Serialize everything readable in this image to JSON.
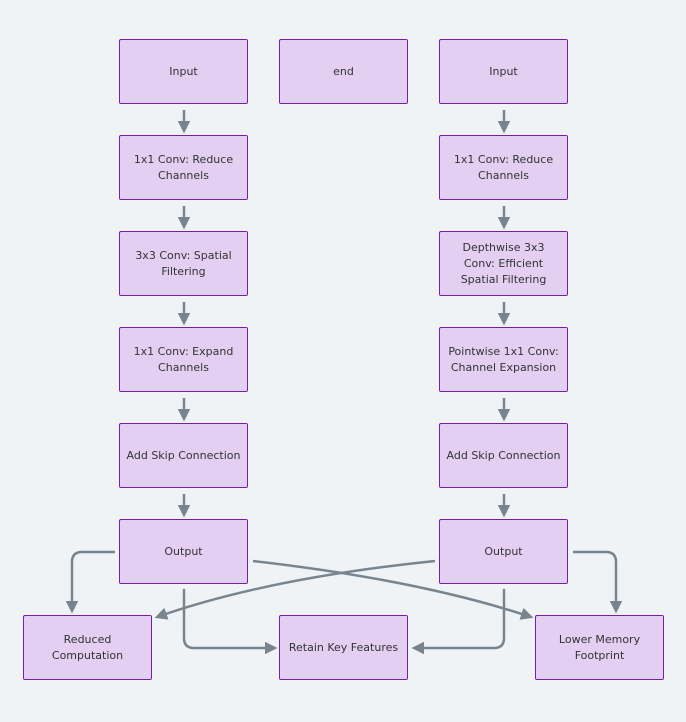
{
  "diagram": {
    "type": "flowchart",
    "colors": {
      "background": "#f0f3f6",
      "node_fill": "#e3cff2",
      "node_border": "#7b1fa2",
      "edge": "#78858f",
      "text": "#333333"
    },
    "nodes": {
      "a_input": "Input",
      "end": "end",
      "b_input": "Input",
      "a_reduce": "1x1 Conv: Reduce Channels",
      "b_reduce": "1x1 Conv: Reduce Channels",
      "a_spatial": "3x3 Conv: Spatial Filtering",
      "b_spatial": "Depthwise 3x3 Conv: Efficient Spatial Filtering",
      "a_expand": "1x1 Conv: Expand Channels",
      "b_expand": "Pointwise 1x1 Conv: Channel Expansion",
      "a_skip": "Add Skip Connection",
      "b_skip": "Add Skip Connection",
      "a_output": "Output",
      "b_output": "Output",
      "reduced_comp": "Reduced Computation",
      "retain": "Retain Key Features",
      "lower_mem": "Lower Memory Footprint"
    },
    "edges": [
      {
        "from": "a_input",
        "to": "a_reduce"
      },
      {
        "from": "a_reduce",
        "to": "a_spatial"
      },
      {
        "from": "a_spatial",
        "to": "a_expand"
      },
      {
        "from": "a_expand",
        "to": "a_skip"
      },
      {
        "from": "a_skip",
        "to": "a_output"
      },
      {
        "from": "b_input",
        "to": "b_reduce"
      },
      {
        "from": "b_reduce",
        "to": "b_spatial"
      },
      {
        "from": "b_spatial",
        "to": "b_expand"
      },
      {
        "from": "b_expand",
        "to": "b_skip"
      },
      {
        "from": "b_skip",
        "to": "b_output"
      },
      {
        "from": "a_output",
        "to": "reduced_comp"
      },
      {
        "from": "a_output",
        "to": "retain"
      },
      {
        "from": "a_output",
        "to": "lower_mem"
      },
      {
        "from": "b_output",
        "to": "reduced_comp"
      },
      {
        "from": "b_output",
        "to": "retain"
      },
      {
        "from": "b_output",
        "to": "lower_mem"
      }
    ]
  }
}
